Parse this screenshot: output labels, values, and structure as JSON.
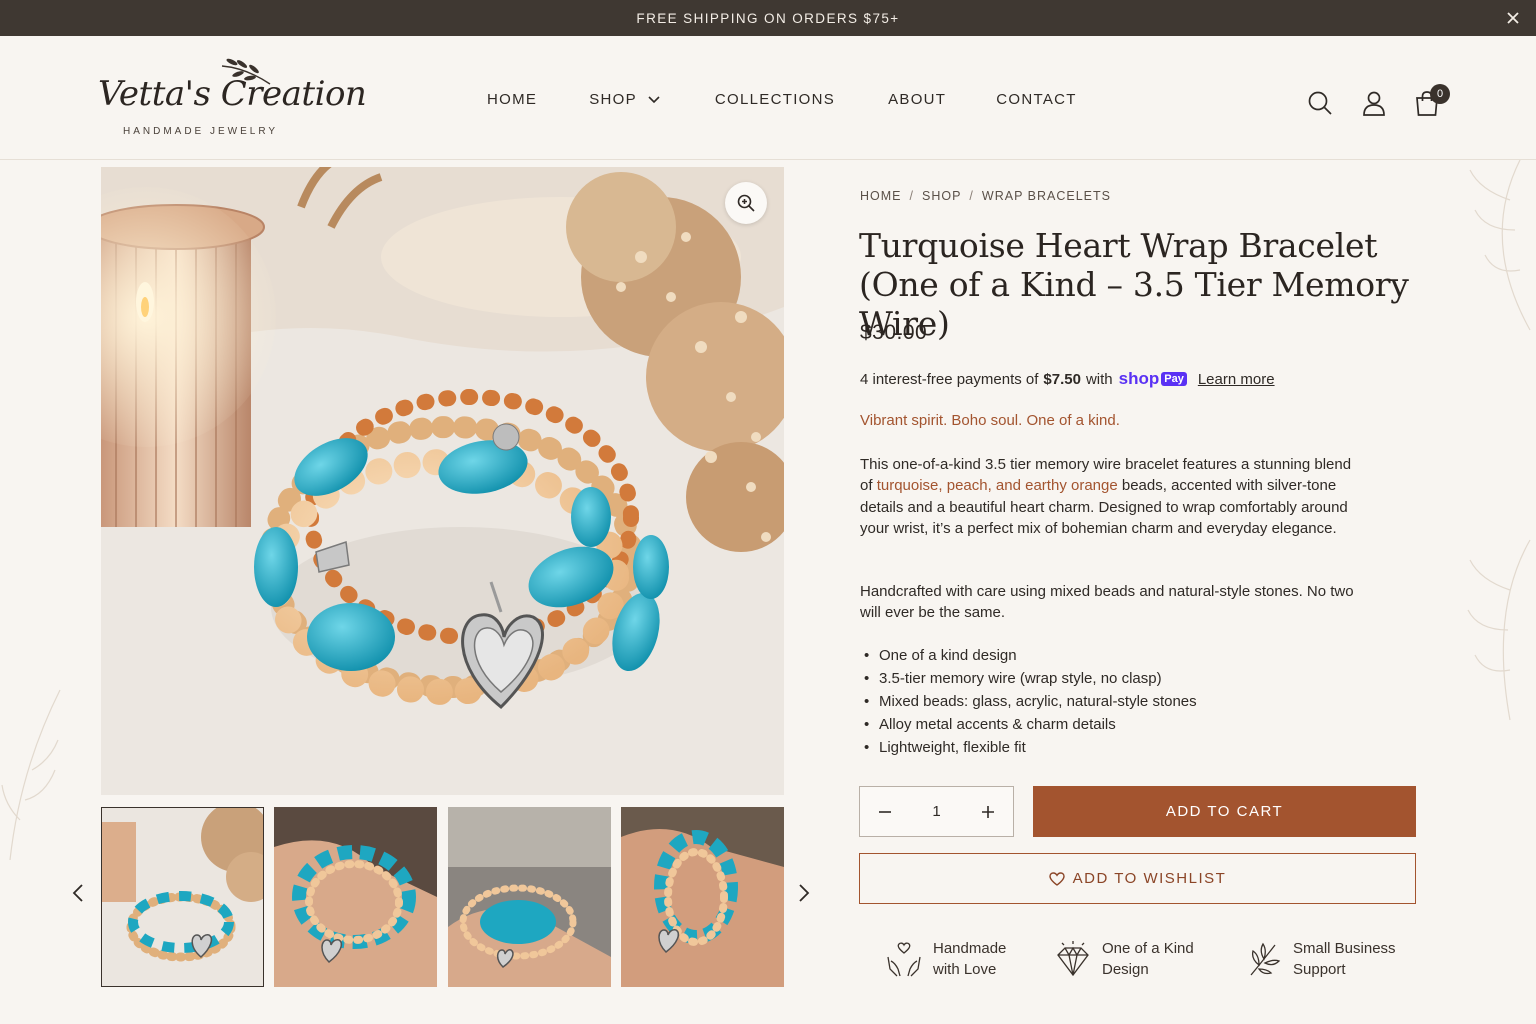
{
  "announcement": {
    "text": "FREE SHIPPING ON ORDERS $75+"
  },
  "brand": {
    "name": "Vetta's Creation",
    "tagline": "HANDMADE JEWELRY"
  },
  "nav": {
    "items": [
      {
        "label": "HOME"
      },
      {
        "label": "SHOP"
      },
      {
        "label": "COLLECTIONS"
      },
      {
        "label": "ABOUT"
      },
      {
        "label": "CONTACT"
      }
    ]
  },
  "cart": {
    "count": "0"
  },
  "breadcrumb": {
    "home": "HOME",
    "shop": "SHOP",
    "category": "WRAP BRACELETS",
    "separator": "/"
  },
  "product": {
    "title": "Turquoise Heart Wrap Bracelet (One of a Kind – 3.5 Tier Memory Wire)",
    "price": "$30.00",
    "installments": {
      "prefix": "4 interest-free payments of",
      "amount": "$7.50",
      "with": "with",
      "provider": "shop",
      "provider_badge": "Pay",
      "learn_more": "Learn more"
    },
    "tagline": "Vibrant spirit. Boho soul. One of a kind.",
    "description": {
      "part1": "This one-of-a-kind 3.5 tier memory wire bracelet features a stunning blend of ",
      "highlight": "turquoise, peach, and earthy orange",
      "part2": " beads, accented with silver-tone details and a beautiful heart charm. Designed to wrap comfortably around your wrist, it’s a perfect mix of bohemian charm and everyday elegance."
    },
    "description2": "Handcrafted with care using mixed beads and natural-style stones. No two will ever be the same.",
    "features": [
      "One of a kind design",
      "3.5-tier memory wire (wrap style, no clasp)",
      "Mixed beads: glass, acrylic, natural-style stones",
      "Alloy metal accents & charm details",
      "Lightweight, flexible fit"
    ],
    "quantity": "1",
    "add_to_cart": "ADD TO CART",
    "add_to_wishlist": "ADD TO WISHLIST"
  },
  "badges": [
    {
      "line1": "Handmade",
      "line2": "with Love",
      "icon": "hands-heart-icon"
    },
    {
      "line1": "One of a Kind",
      "line2": "Design",
      "icon": "diamond-icon"
    },
    {
      "line1": "Small Business",
      "line2": "Support",
      "icon": "leaf-icon"
    }
  ],
  "colors": {
    "accent": "#a3542f",
    "topbar": "#3f3832",
    "background": "#f8f5f1",
    "turquoise": "#1ea7c1",
    "peach": "#f0c79a"
  }
}
